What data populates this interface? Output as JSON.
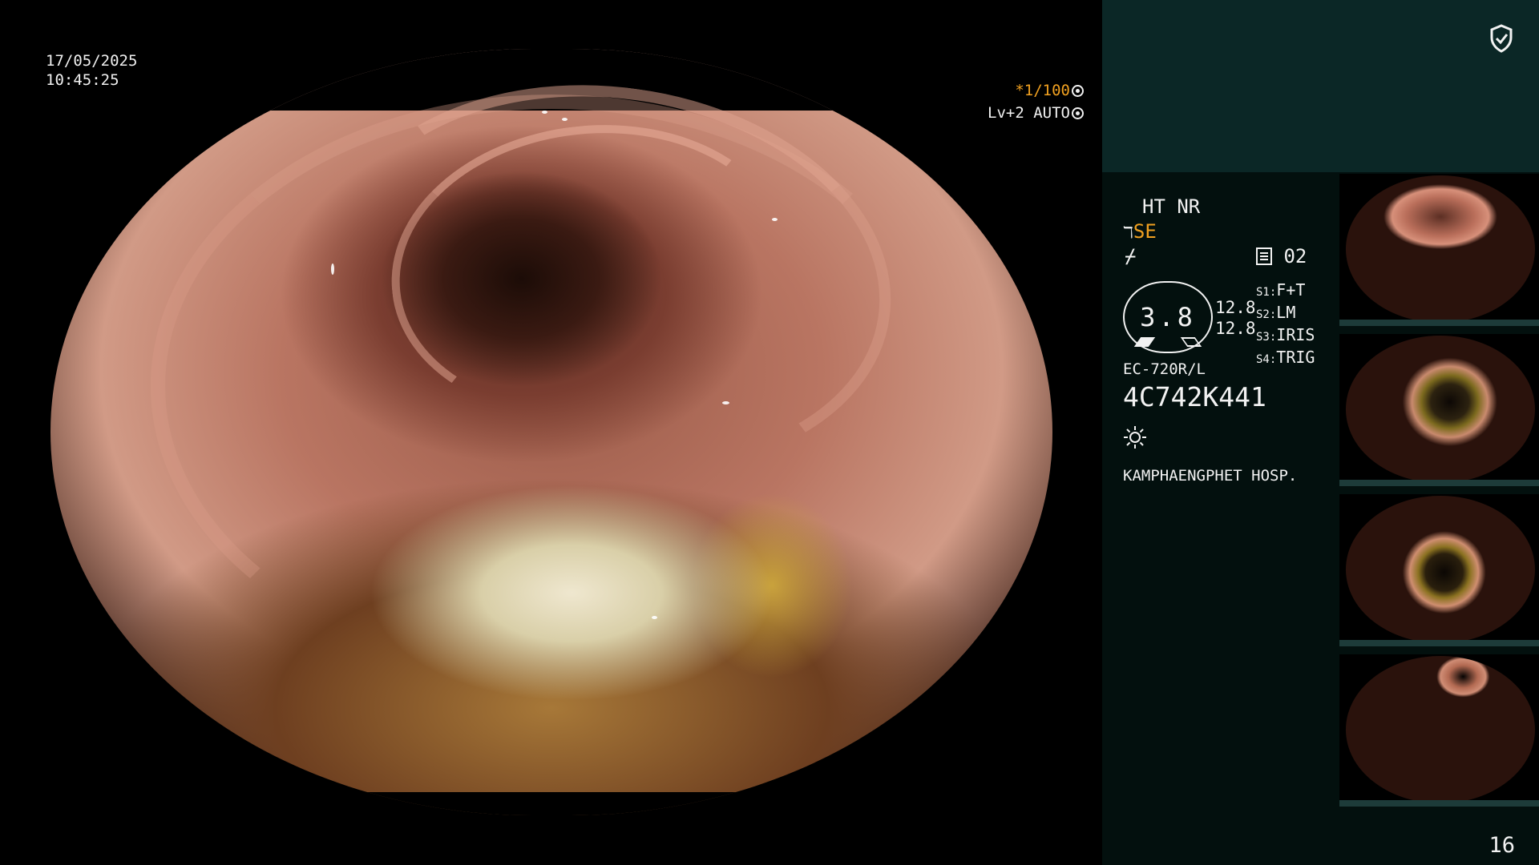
{
  "overlay": {
    "date": "17/05/2025",
    "time": "10:45:25",
    "shutter": "*1/100",
    "light_mode": "Lv+2 AUTO"
  },
  "panel": {
    "mode_line": "HT NR",
    "se_label": "SE",
    "counter_label": "02",
    "scope_value": "3.8",
    "scale_top": "12.8",
    "scale_bottom": "12.8",
    "switches": [
      {
        "key": "S1",
        "value": "F+T"
      },
      {
        "key": "S2",
        "value": "LM"
      },
      {
        "key": "S3",
        "value": "IRIS"
      },
      {
        "key": "S4",
        "value": "TRIG"
      }
    ],
    "scope_model": "EC-720R/L",
    "serial": "4C742K441",
    "hospital": "KAMPHAENGPHET HOSP."
  },
  "page_number": "16",
  "icons": {
    "shield": "shield-check-icon",
    "brightness": "sun-icon",
    "memory": "memory-card-icon"
  },
  "colors": {
    "accent": "#f0a020",
    "panel_top": "#0b2726",
    "panel_bg": "#03100e"
  }
}
